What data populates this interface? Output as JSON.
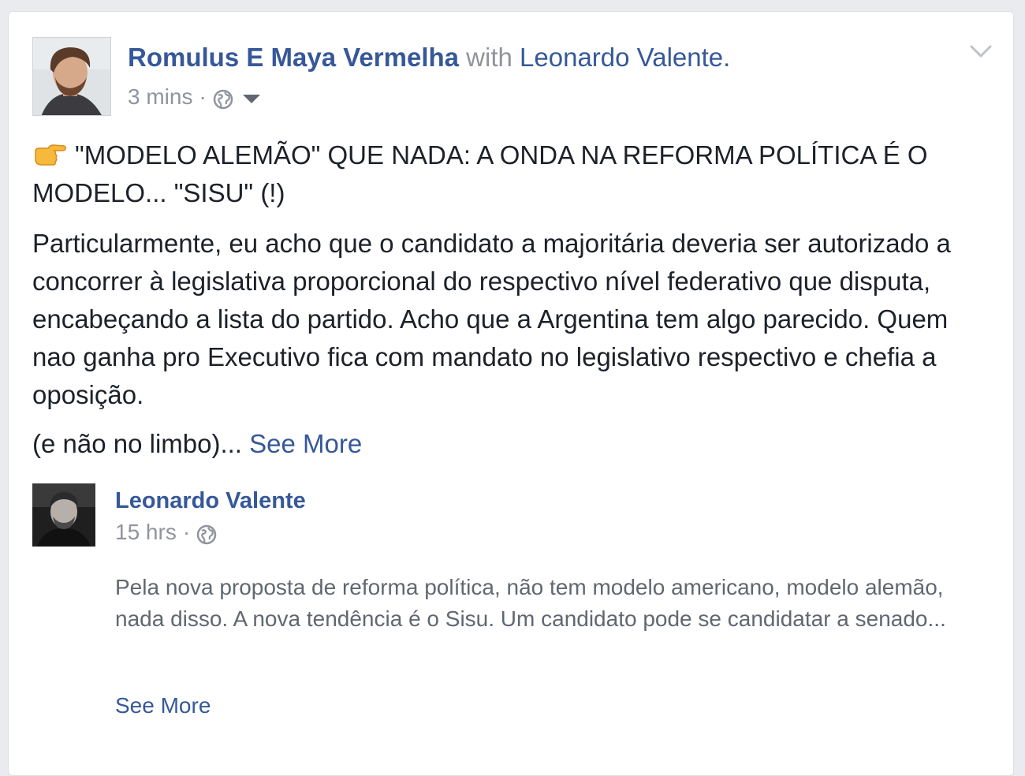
{
  "post": {
    "author": "Romulus E Maya Vermelha",
    "with_word": "with",
    "tagged": "Leonardo Valente.",
    "timestamp": "3 mins",
    "separator": "·",
    "privacy_icon": "globe-icon",
    "audience_menu_icon": "caret-down-icon",
    "options_icon": "chevron-down-icon",
    "headline_emoji": "pointing-right-hand-emoji",
    "headline": "\"MODELO ALEMÃO\" QUE NADA: A ONDA NA REFORMA POLÍTICA É O MODELO... \"SISU\" (!)",
    "body": "Particularmente, eu acho que o candidato a majoritária deveria ser autorizado a concorrer à legislativa proporcional do respectivo nível federativo que disputa, encabeçando a lista do partido. Acho que a Argentina tem algo parecido. Quem nao ganha pro Executivo fica com mandato no legislativo respectivo e chefia a oposição.",
    "tail": "(e não no limbo)...",
    "see_more": "See More"
  },
  "shared": {
    "author": "Leonardo Valente",
    "timestamp": "15 hrs",
    "separator": "·",
    "privacy_icon": "globe-icon",
    "text": "Pela nova proposta de reforma política, não tem modelo americano, modelo alemão, nada disso. A nova tendência é o Sisu. Um candidato pode se candidatar a senado...",
    "see_more": "See More"
  },
  "colors": {
    "link": "#365899",
    "meta": "#90949c",
    "text": "#1d2129",
    "shared_text": "#616770"
  }
}
